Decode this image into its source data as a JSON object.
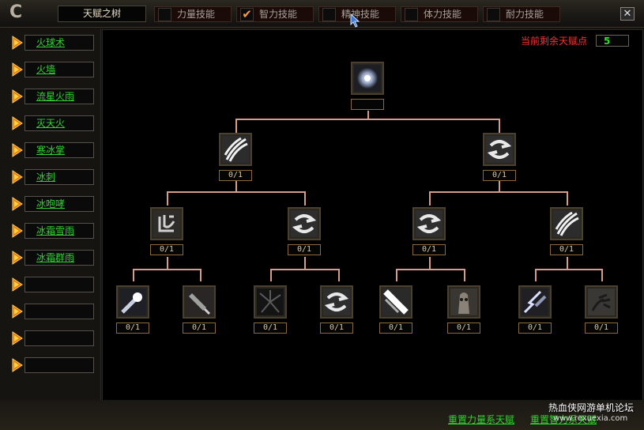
{
  "window": {
    "title": "天赋之树",
    "close_label": "✕",
    "logo_glyph": "C"
  },
  "tabs": [
    {
      "label": "力量技能",
      "checked": false
    },
    {
      "label": "智力技能",
      "checked": true
    },
    {
      "label": "精神技能",
      "checked": false
    },
    {
      "label": "体力技能",
      "checked": false
    },
    {
      "label": "耐力技能",
      "checked": false
    }
  ],
  "checkmark": "✔",
  "sidebar": {
    "items": [
      {
        "label": "火球术"
      },
      {
        "label": "火墙"
      },
      {
        "label": "流星火雨"
      },
      {
        "label": "灭天火"
      },
      {
        "label": "寒冰掌"
      },
      {
        "label": "冰刺"
      },
      {
        "label": "冰咆哮"
      },
      {
        "label": "冰霜雪雨"
      },
      {
        "label": "冰霜群雨"
      },
      {
        "label": ""
      },
      {
        "label": ""
      },
      {
        "label": ""
      },
      {
        "label": ""
      }
    ]
  },
  "points": {
    "label": "当前剩余天赋点",
    "value": "5"
  },
  "tree": {
    "root": {
      "count": "",
      "icon": "orb-icon"
    },
    "level1": [
      {
        "count": "0/1",
        "icon": "claw-slash-icon"
      },
      {
        "count": "0/1",
        "icon": "swirl-icon"
      }
    ],
    "level2": [
      {
        "count": "0/1",
        "icon": "rune-icon"
      },
      {
        "count": "0/1",
        "icon": "swirl-icon"
      },
      {
        "count": "0/1",
        "icon": "swirl-icon"
      },
      {
        "count": "0/1",
        "icon": "claw-slash-icon"
      }
    ],
    "level3": [
      {
        "count": "0/1",
        "icon": "comet-icon"
      },
      {
        "count": "0/1",
        "icon": "dagger-icon"
      },
      {
        "count": "0/1",
        "icon": "shadow-burst-icon"
      },
      {
        "count": "0/1",
        "icon": "swirl-icon"
      },
      {
        "count": "0/1",
        "icon": "light-beam-icon"
      },
      {
        "count": "0/1",
        "icon": "tree-face-icon"
      },
      {
        "count": "0/1",
        "icon": "lightning-arm-icon"
      },
      {
        "count": "0/1",
        "icon": "claw-hand-icon"
      }
    ]
  },
  "footer": {
    "reset_strength": "重置力量系天赋",
    "reset_other": "重置智力系天赋",
    "watermark": "热血侠网游单机论坛",
    "watermark_url": "www.rexuexia.com"
  }
}
